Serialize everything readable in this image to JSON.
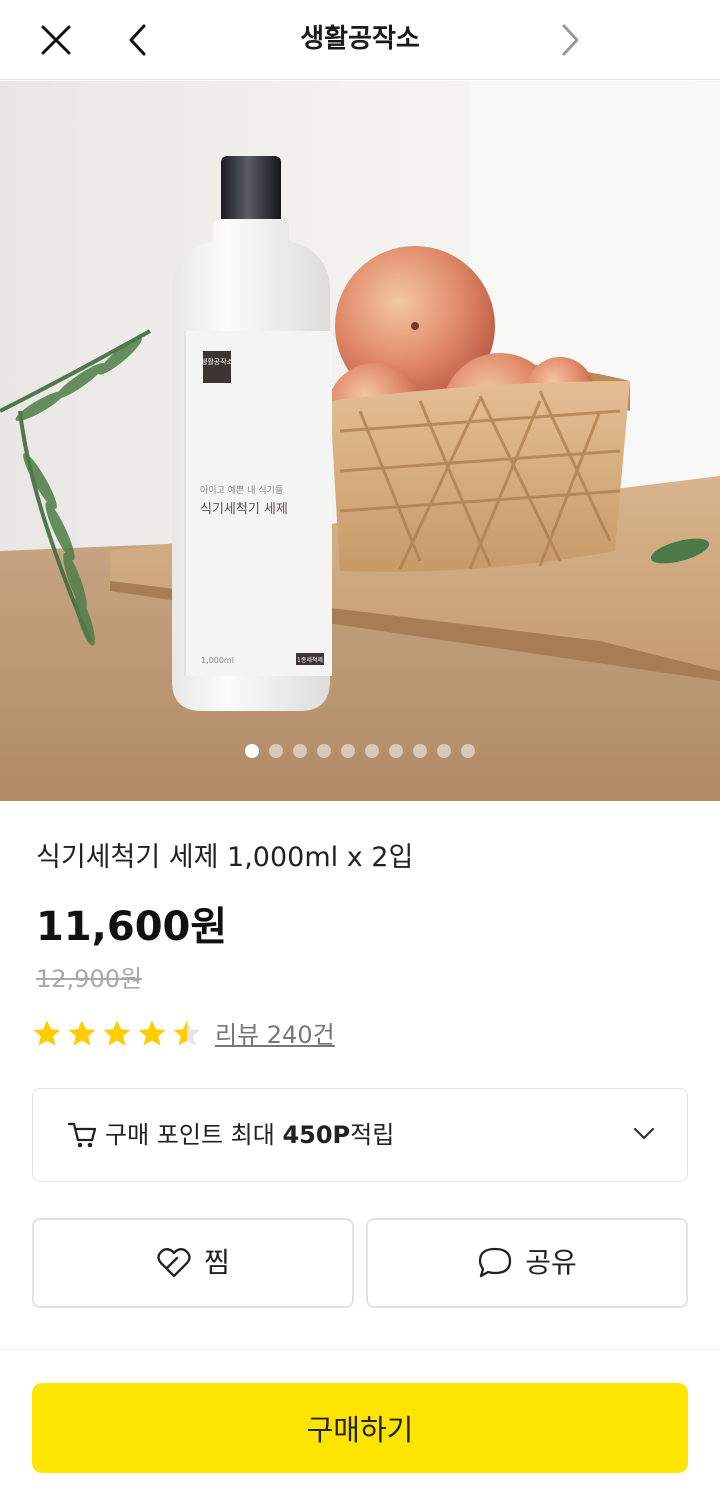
{
  "header": {
    "title": "생활공작소",
    "close_icon": "close-icon",
    "back_icon": "chevron-left-icon",
    "forward_icon": "chevron-right-icon"
  },
  "gallery": {
    "image_count": 10,
    "active_index": 0,
    "bottle_label": {
      "brand_badge": "생활공작소",
      "tagline": "아이고 예쁜 내 식기들",
      "product": "식기세척기 세제",
      "volume": "1,000ml",
      "tag": "1종세척제"
    }
  },
  "product": {
    "name": "식기세척기 세제 1,000ml x 2입",
    "price": "11,600원",
    "original_price": "12,900원",
    "rating": 4.5,
    "review_label": "리뷰 240건"
  },
  "points": {
    "prefix": "구매 포인트 최대 ",
    "amount": "450P",
    "suffix": "적립",
    "icon": "cart-icon"
  },
  "actions": {
    "wish_label": "찜",
    "share_label": "공유"
  },
  "buy_button": {
    "label": "구매하기",
    "color": "#fee500"
  }
}
